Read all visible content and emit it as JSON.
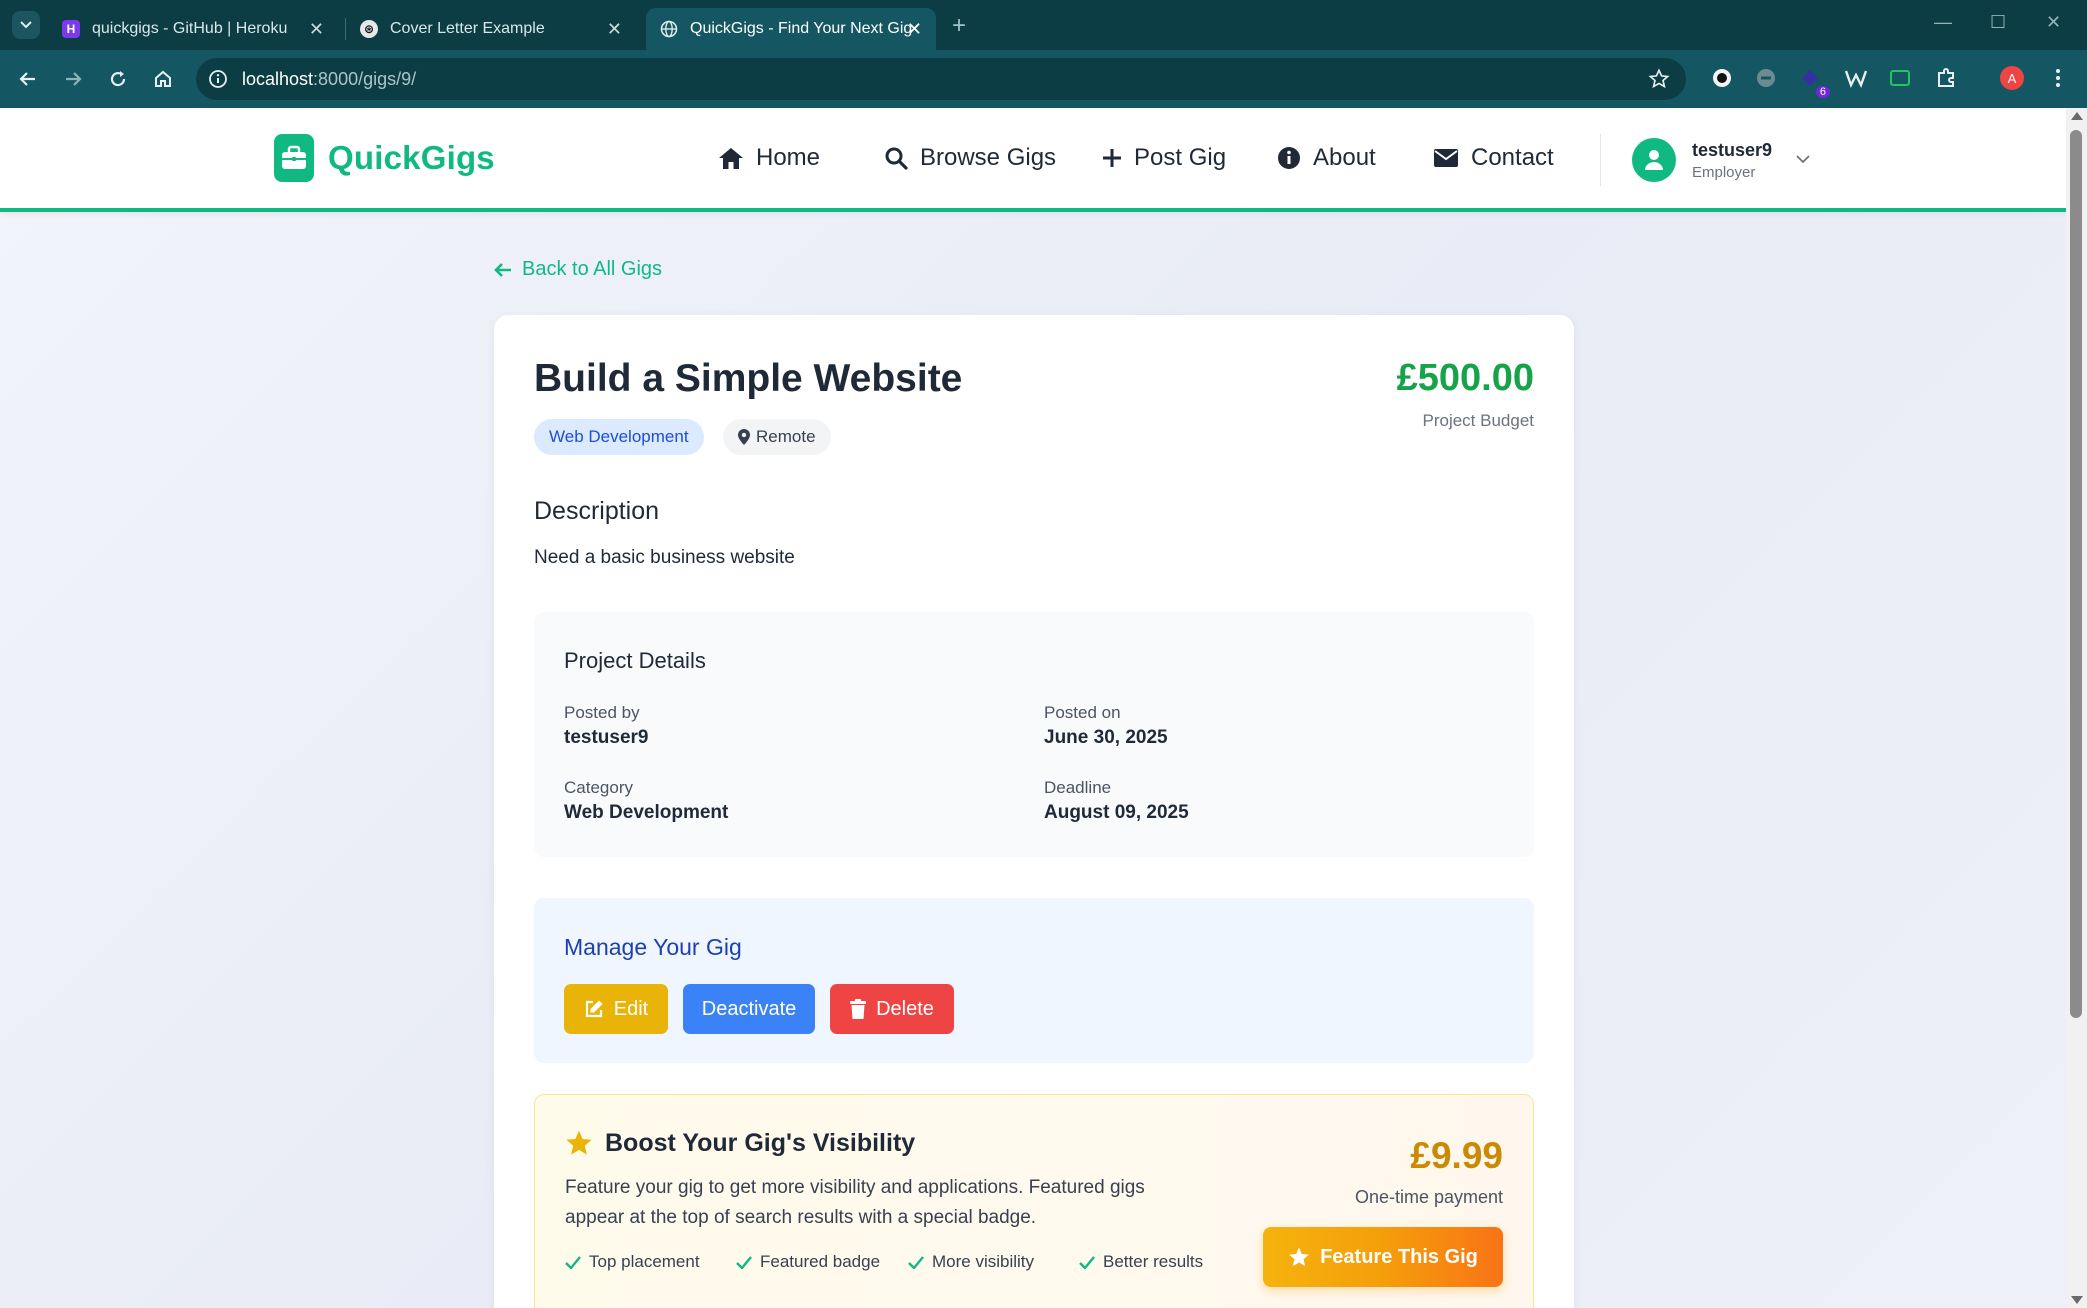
{
  "browser": {
    "tabs": [
      {
        "title": "quickgigs - GitHub | Heroku",
        "active": false
      },
      {
        "title": "Cover Letter Example",
        "active": false
      },
      {
        "title": "QuickGigs - Find Your Next Gig",
        "active": true
      }
    ],
    "url": {
      "host": "localhost",
      "path": ":8000/gigs/9/"
    },
    "extension_badge": "6",
    "profile_initial": "A"
  },
  "site": {
    "brand": "QuickGigs",
    "nav": [
      {
        "label": "Home",
        "icon": "home-icon"
      },
      {
        "label": "Browse Gigs",
        "icon": "search-icon"
      },
      {
        "label": "Post Gig",
        "icon": "plus-icon"
      },
      {
        "label": "About",
        "icon": "info-icon"
      },
      {
        "label": "Contact",
        "icon": "envelope-icon"
      }
    ],
    "user": {
      "name": "testuser9",
      "role": "Employer"
    },
    "colors": {
      "brand": "#10b981",
      "price": "#16a34a",
      "edit": "#eab308",
      "deactivate": "#3b82f6",
      "delete": "#ef4444"
    }
  },
  "gig": {
    "back_label": "Back to All Gigs",
    "title": "Build a Simple Website",
    "price": "£500.00",
    "price_label": "Project Budget",
    "category_chip": "Web Development",
    "location_chip": "Remote",
    "description_heading": "Description",
    "description": "Need a basic business website",
    "details": {
      "heading": "Project Details",
      "posted_by_label": "Posted by",
      "posted_by": "testuser9",
      "posted_on_label": "Posted on",
      "posted_on": "June 30, 2025",
      "category_label": "Category",
      "category": "Web Development",
      "deadline_label": "Deadline",
      "deadline": "August 09, 2025"
    },
    "manage": {
      "heading": "Manage Your Gig",
      "edit": "Edit",
      "deactivate": "Deactivate",
      "delete": "Delete"
    },
    "boost": {
      "heading": "Boost Your Gig's Visibility",
      "text": "Feature your gig to get more visibility and applications. Featured gigs appear at the top of search results with a special badge.",
      "features": [
        "Top placement",
        "Featured badge",
        "More visibility",
        "Better results"
      ],
      "price": "£9.99",
      "price_label": "One-time payment",
      "button": "Feature This Gig"
    }
  }
}
